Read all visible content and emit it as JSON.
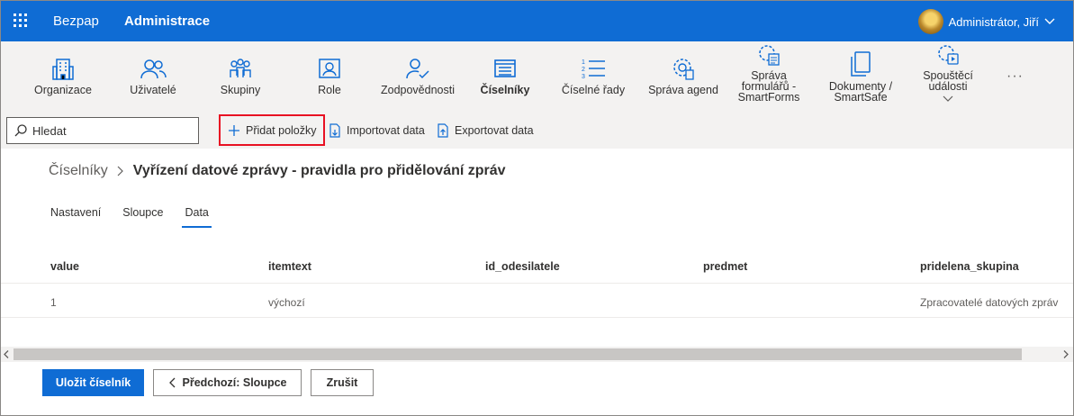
{
  "header": {
    "brand": "Bezpap",
    "app_title": "Administrace",
    "user_name": "Administrátor, Jiří"
  },
  "ribbon": {
    "items": [
      {
        "label": "Organizace",
        "icon": "building-icon"
      },
      {
        "label": "Uživatelé",
        "icon": "users-icon"
      },
      {
        "label": "Skupiny",
        "icon": "groups-icon"
      },
      {
        "label": "Role",
        "icon": "role-card-icon"
      },
      {
        "label": "Zodpovědnosti",
        "icon": "user-check-icon"
      },
      {
        "label": "Číselníky",
        "icon": "list-box-icon",
        "active": true
      },
      {
        "label": "Číselné řady",
        "icon": "numbered-list-icon"
      },
      {
        "label": "Správa agend",
        "icon": "gear-document-icon"
      },
      {
        "label": "Správa formulářů - SmartForms",
        "icon": "gear-form-icon"
      },
      {
        "label": "Dokumenty / SmartSafe",
        "icon": "documents-icon"
      },
      {
        "label": "Spouštěcí události",
        "icon": "gear-play-icon"
      }
    ],
    "more": "···"
  },
  "commands": {
    "search_placeholder": "Hledat",
    "add_items": "Přidat položky",
    "import": "Importovat data",
    "export": "Exportovat data"
  },
  "breadcrumb": {
    "parent": "Číselníky",
    "current": "Vyřízení datové zprávy - pravidla pro přidělování zpráv"
  },
  "tabs": [
    {
      "label": "Nastavení"
    },
    {
      "label": "Sloupce"
    },
    {
      "label": "Data",
      "active": true
    }
  ],
  "table": {
    "columns": [
      "value",
      "itemtext",
      "id_odesilatele",
      "predmet",
      "pridelena_skupina"
    ],
    "rows": [
      [
        "1",
        "výchozí",
        "",
        "",
        "Zpracovatelé datových zpráv"
      ]
    ]
  },
  "footer": {
    "save": "Uložit číselník",
    "previous": "Předchozí: Sloupce",
    "cancel": "Zrušit"
  },
  "colors": {
    "accent": "#0f6cd4",
    "highlight_border": "#e81123"
  }
}
